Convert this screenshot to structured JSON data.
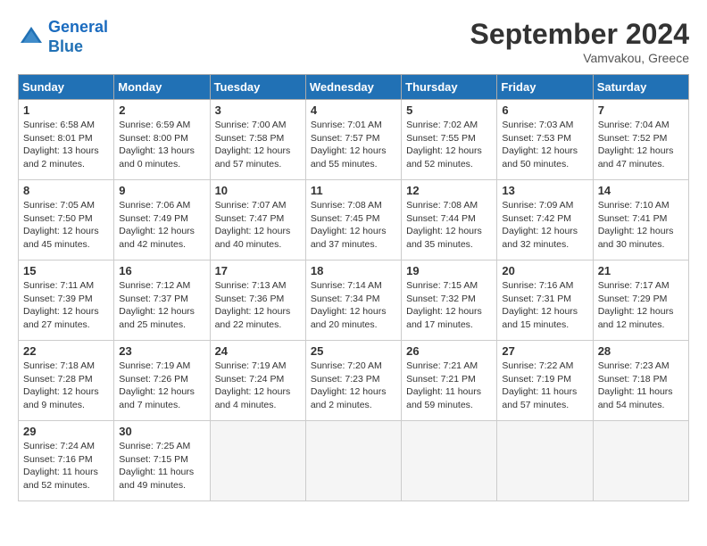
{
  "header": {
    "logo_line1": "General",
    "logo_line2": "Blue",
    "month": "September 2024",
    "location": "Vamvakou, Greece"
  },
  "weekdays": [
    "Sunday",
    "Monday",
    "Tuesday",
    "Wednesday",
    "Thursday",
    "Friday",
    "Saturday"
  ],
  "weeks": [
    [
      {
        "day": "1",
        "info": "Sunrise: 6:58 AM\nSunset: 8:01 PM\nDaylight: 13 hours\nand 2 minutes."
      },
      {
        "day": "2",
        "info": "Sunrise: 6:59 AM\nSunset: 8:00 PM\nDaylight: 13 hours\nand 0 minutes."
      },
      {
        "day": "3",
        "info": "Sunrise: 7:00 AM\nSunset: 7:58 PM\nDaylight: 12 hours\nand 57 minutes."
      },
      {
        "day": "4",
        "info": "Sunrise: 7:01 AM\nSunset: 7:57 PM\nDaylight: 12 hours\nand 55 minutes."
      },
      {
        "day": "5",
        "info": "Sunrise: 7:02 AM\nSunset: 7:55 PM\nDaylight: 12 hours\nand 52 minutes."
      },
      {
        "day": "6",
        "info": "Sunrise: 7:03 AM\nSunset: 7:53 PM\nDaylight: 12 hours\nand 50 minutes."
      },
      {
        "day": "7",
        "info": "Sunrise: 7:04 AM\nSunset: 7:52 PM\nDaylight: 12 hours\nand 47 minutes."
      }
    ],
    [
      {
        "day": "8",
        "info": "Sunrise: 7:05 AM\nSunset: 7:50 PM\nDaylight: 12 hours\nand 45 minutes."
      },
      {
        "day": "9",
        "info": "Sunrise: 7:06 AM\nSunset: 7:49 PM\nDaylight: 12 hours\nand 42 minutes."
      },
      {
        "day": "10",
        "info": "Sunrise: 7:07 AM\nSunset: 7:47 PM\nDaylight: 12 hours\nand 40 minutes."
      },
      {
        "day": "11",
        "info": "Sunrise: 7:08 AM\nSunset: 7:45 PM\nDaylight: 12 hours\nand 37 minutes."
      },
      {
        "day": "12",
        "info": "Sunrise: 7:08 AM\nSunset: 7:44 PM\nDaylight: 12 hours\nand 35 minutes."
      },
      {
        "day": "13",
        "info": "Sunrise: 7:09 AM\nSunset: 7:42 PM\nDaylight: 12 hours\nand 32 minutes."
      },
      {
        "day": "14",
        "info": "Sunrise: 7:10 AM\nSunset: 7:41 PM\nDaylight: 12 hours\nand 30 minutes."
      }
    ],
    [
      {
        "day": "15",
        "info": "Sunrise: 7:11 AM\nSunset: 7:39 PM\nDaylight: 12 hours\nand 27 minutes."
      },
      {
        "day": "16",
        "info": "Sunrise: 7:12 AM\nSunset: 7:37 PM\nDaylight: 12 hours\nand 25 minutes."
      },
      {
        "day": "17",
        "info": "Sunrise: 7:13 AM\nSunset: 7:36 PM\nDaylight: 12 hours\nand 22 minutes."
      },
      {
        "day": "18",
        "info": "Sunrise: 7:14 AM\nSunset: 7:34 PM\nDaylight: 12 hours\nand 20 minutes."
      },
      {
        "day": "19",
        "info": "Sunrise: 7:15 AM\nSunset: 7:32 PM\nDaylight: 12 hours\nand 17 minutes."
      },
      {
        "day": "20",
        "info": "Sunrise: 7:16 AM\nSunset: 7:31 PM\nDaylight: 12 hours\nand 15 minutes."
      },
      {
        "day": "21",
        "info": "Sunrise: 7:17 AM\nSunset: 7:29 PM\nDaylight: 12 hours\nand 12 minutes."
      }
    ],
    [
      {
        "day": "22",
        "info": "Sunrise: 7:18 AM\nSunset: 7:28 PM\nDaylight: 12 hours\nand 9 minutes."
      },
      {
        "day": "23",
        "info": "Sunrise: 7:19 AM\nSunset: 7:26 PM\nDaylight: 12 hours\nand 7 minutes."
      },
      {
        "day": "24",
        "info": "Sunrise: 7:19 AM\nSunset: 7:24 PM\nDaylight: 12 hours\nand 4 minutes."
      },
      {
        "day": "25",
        "info": "Sunrise: 7:20 AM\nSunset: 7:23 PM\nDaylight: 12 hours\nand 2 minutes."
      },
      {
        "day": "26",
        "info": "Sunrise: 7:21 AM\nSunset: 7:21 PM\nDaylight: 11 hours\nand 59 minutes."
      },
      {
        "day": "27",
        "info": "Sunrise: 7:22 AM\nSunset: 7:19 PM\nDaylight: 11 hours\nand 57 minutes."
      },
      {
        "day": "28",
        "info": "Sunrise: 7:23 AM\nSunset: 7:18 PM\nDaylight: 11 hours\nand 54 minutes."
      }
    ],
    [
      {
        "day": "29",
        "info": "Sunrise: 7:24 AM\nSunset: 7:16 PM\nDaylight: 11 hours\nand 52 minutes."
      },
      {
        "day": "30",
        "info": "Sunrise: 7:25 AM\nSunset: 7:15 PM\nDaylight: 11 hours\nand 49 minutes."
      },
      null,
      null,
      null,
      null,
      null
    ]
  ]
}
